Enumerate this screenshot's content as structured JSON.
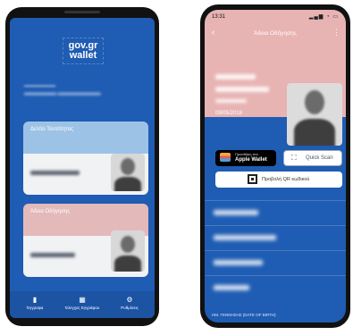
{
  "left_phone": {
    "logo_line1": "gov.gr",
    "logo_line2": "wallet",
    "cards": [
      {
        "title": "Δελτίο Ταυτότητας",
        "color": "#9cc3e6"
      },
      {
        "title": "Άδεια Οδήγησης",
        "color": "#e4b9b9"
      }
    ],
    "nav": [
      {
        "label": "Έγγραφα",
        "icon": "document-icon"
      },
      {
        "label": "Έλεγχος Εγγράφου",
        "icon": "qr-grid-icon"
      },
      {
        "label": "Ρυθμίσεις",
        "icon": "gear-icon"
      }
    ],
    "background_color": "#1f5cb3"
  },
  "right_phone": {
    "status_time": "13:31",
    "header_title": "Άδεια Οδήγησης",
    "date": "09/05/2018",
    "apple_wallet_small": "Προσθήκη στο",
    "apple_wallet_label": "Apple Wallet",
    "quick_scan_label": "Quick Scan",
    "qr_label": "Προβολή QR κωδικού",
    "footer_text": "ΗΜ. ΓΕΝΝΗΣΗΣ (DATE OF BIRTH)",
    "header_color": "#e8b3b3"
  }
}
